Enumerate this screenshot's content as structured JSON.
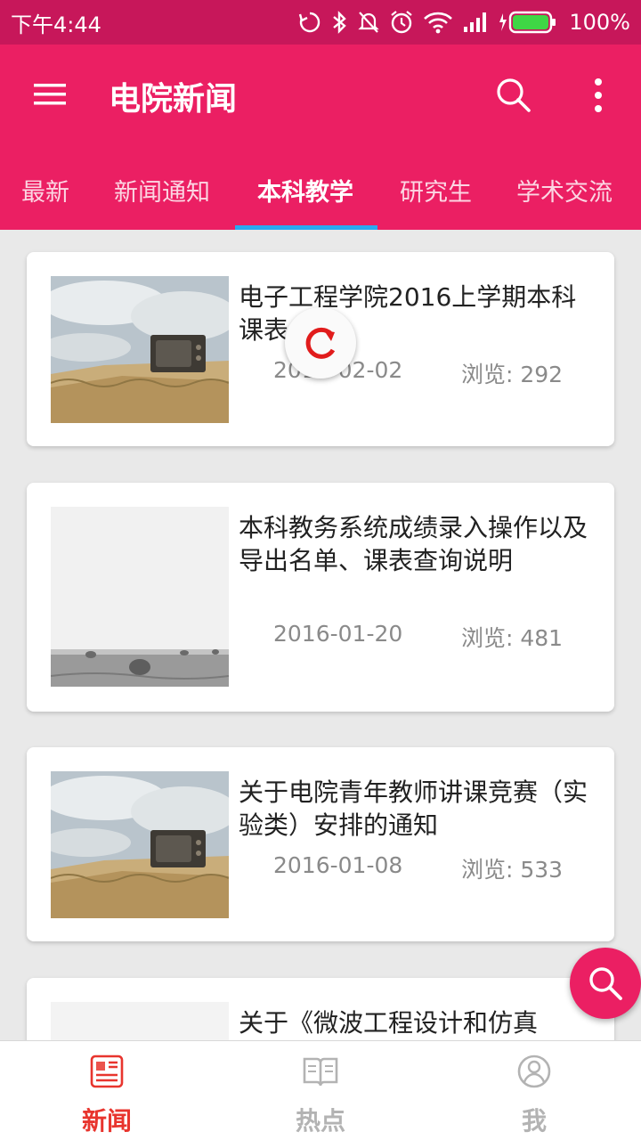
{
  "status_bar": {
    "time": "下午4:44",
    "battery": "100%"
  },
  "app_bar": {
    "title": "电院新闻"
  },
  "tabs": [
    {
      "label": "最新"
    },
    {
      "label": "新闻通知"
    },
    {
      "label": "本科教学"
    },
    {
      "label": "研究生"
    },
    {
      "label": "学术交流"
    }
  ],
  "active_tab": "本科教学",
  "news": [
    {
      "title": "电子工程学院2016上学期本科课表",
      "date": "2016-02-02",
      "views": "浏览: 292",
      "thumb": "tv-field"
    },
    {
      "title": "本科教务系统成绩录入操作以及导出名单、课表查询说明",
      "date": "2016-01-20",
      "views": "浏览: 481",
      "thumb": "hay-field"
    },
    {
      "title": "关于电院青年教师讲课竞赛（实验类）安排的通知",
      "date": "2016-01-08",
      "views": "浏览: 533",
      "thumb": "tv-field"
    },
    {
      "title": "关于《微波工程设计和仿真",
      "date": "",
      "views": "",
      "thumb": "hay-field"
    }
  ],
  "bottom_nav": [
    {
      "label": "新闻",
      "icon": "newspaper-icon",
      "active": true
    },
    {
      "label": "热点",
      "icon": "book-icon",
      "active": false
    },
    {
      "label": "我",
      "icon": "user-icon",
      "active": false
    }
  ],
  "colors": {
    "primary": "#eb1f63",
    "status_bar": "#c7175a",
    "tab_indicator": "#2aa8f0",
    "nav_active": "#e8352e",
    "nav_inactive": "#b3b3b3"
  }
}
